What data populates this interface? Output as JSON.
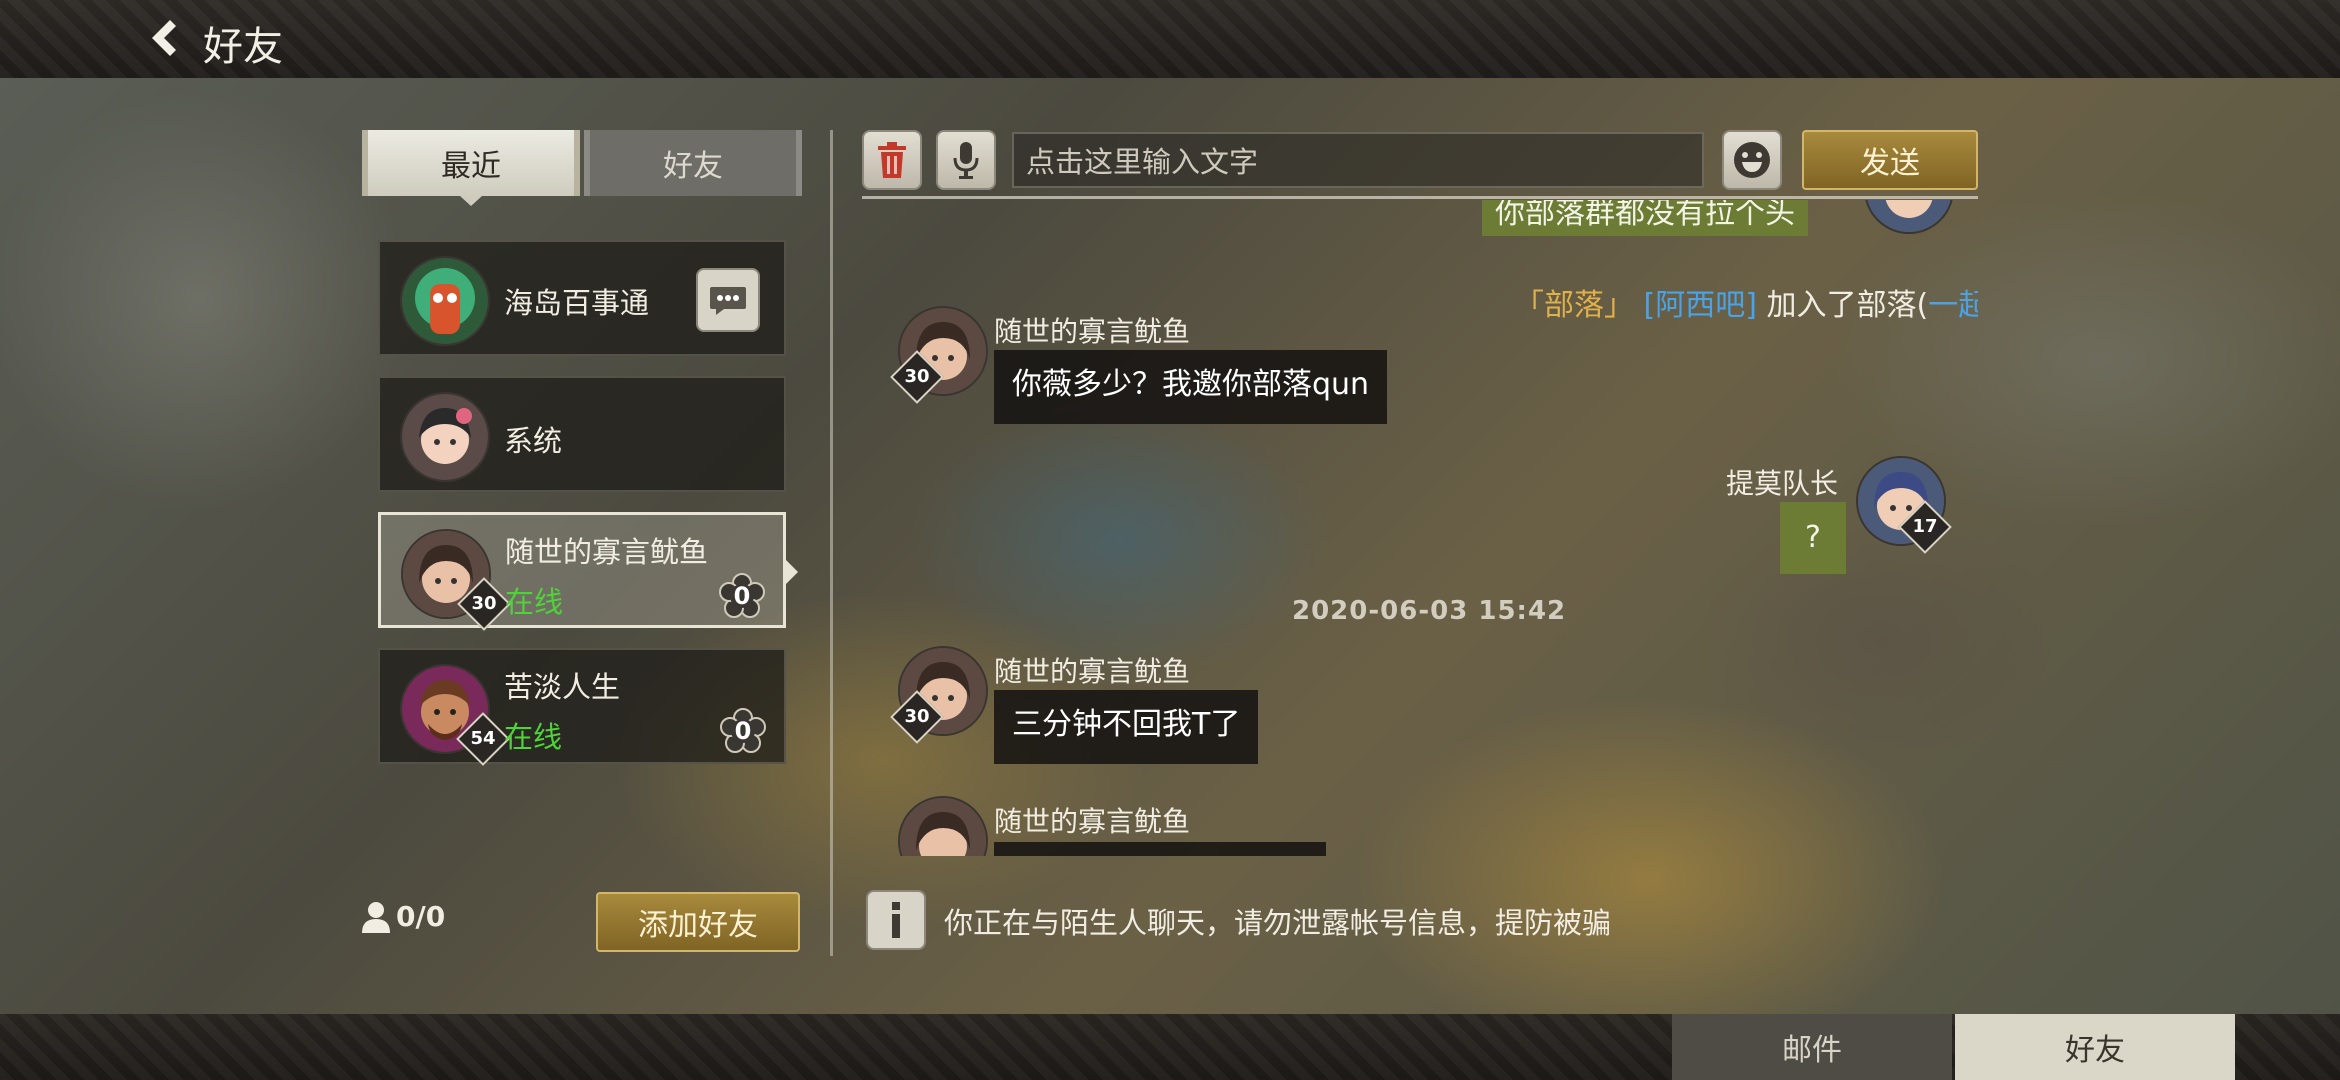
{
  "header": {
    "title": "好友"
  },
  "left_panel": {
    "tabs": [
      {
        "label": "最近",
        "active": true
      },
      {
        "label": "好友",
        "active": false
      }
    ],
    "contacts": [
      {
        "name": "海岛百事通",
        "status": "",
        "level": "",
        "count": "",
        "has_message_icon": true
      },
      {
        "name": "系统",
        "status": "",
        "level": "",
        "count": ""
      },
      {
        "name": "随世的寡言鱿鱼",
        "status": "在线",
        "level": "30",
        "count": "0",
        "selected": true
      },
      {
        "name": "苦淡人生",
        "status": "在线",
        "level": "54",
        "count": "0"
      }
    ],
    "online_count": "0/0",
    "add_friend_label": "添加好友"
  },
  "chat": {
    "input_placeholder": "点击这里输入文字",
    "send_label": "发送",
    "partial_top_message": "你部落群都没有拉个头",
    "system_message": {
      "part1": "「部落」",
      "part2": "[阿西吧]",
      "part3": "加入了部落(",
      "part4": "一起欢迎吧~",
      "part5": ")"
    },
    "messages": [
      {
        "sender": "随世的寡言鱿鱼",
        "level": "30",
        "text": "你薇多少？我邀你部落qun",
        "side": "left"
      },
      {
        "sender": "提莫队长",
        "level": "17",
        "text": "?",
        "side": "right"
      },
      {
        "sender": "随世的寡言鱿鱼",
        "level": "30",
        "text": "三分钟不回我T了",
        "side": "left"
      },
      {
        "sender": "随世的寡言鱿鱼",
        "level": "",
        "text": "",
        "side": "left"
      }
    ],
    "timestamp": "2020-06-03  15:42",
    "notice": "你正在与陌生人聊天，请勿泄露帐号信息，提防被骗"
  },
  "bottom_tabs": [
    {
      "label": "邮件",
      "active": false
    },
    {
      "label": "好友",
      "active": true
    }
  ],
  "colors": {
    "online_green": "#4fd23a",
    "gold_button": "#8f7430",
    "guild_tag": "#e0b04a",
    "player_tag": "#4aa3e6",
    "welcome_text": "#4aa3e6"
  }
}
